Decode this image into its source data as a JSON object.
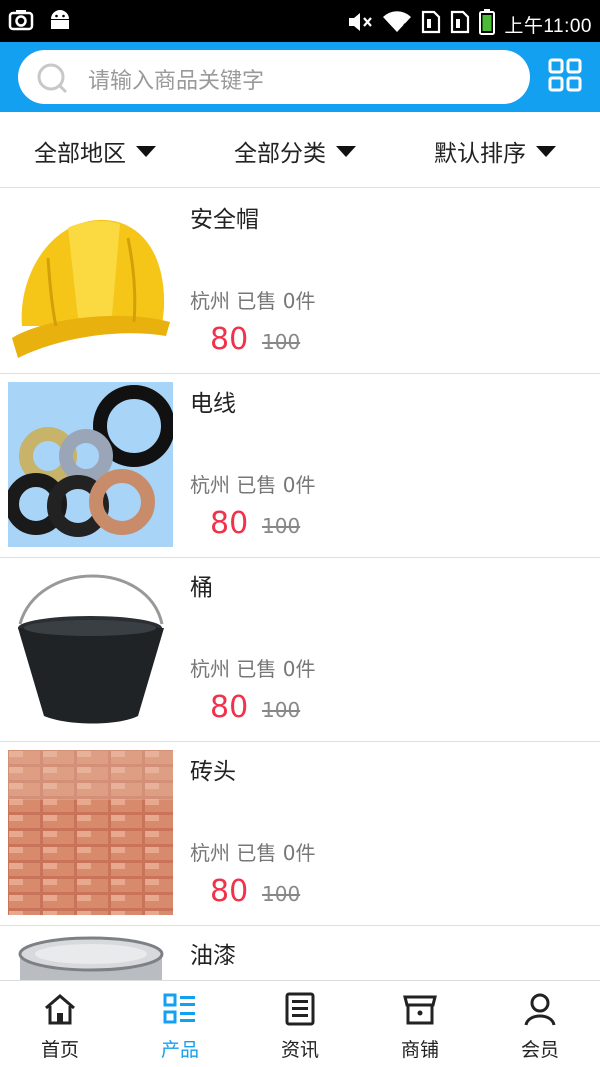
{
  "status_bar": {
    "time": "上午11:00",
    "left_icons": [
      "camera-icon",
      "android-icon"
    ],
    "right_icons": [
      "mute-icon",
      "wifi-icon",
      "sim1-icon",
      "sim2-icon",
      "battery-icon"
    ]
  },
  "search": {
    "placeholder": "请输入商品关键字"
  },
  "header": {
    "accent_color": "#14a0f0",
    "menu_icon": "grid-icon"
  },
  "filters": [
    {
      "label": "全部地区"
    },
    {
      "label": "全部分类"
    },
    {
      "label": "默认排序"
    }
  ],
  "products": [
    {
      "name": "安全帽",
      "meta": "杭州 已售 0件",
      "price": "80",
      "old_price": "100",
      "image": "hard-hat"
    },
    {
      "name": "电线",
      "meta": "杭州 已售 0件",
      "price": "80",
      "old_price": "100",
      "image": "wire-coils"
    },
    {
      "name": "桶",
      "meta": "杭州 已售 0件",
      "price": "80",
      "old_price": "100",
      "image": "bucket"
    },
    {
      "name": "砖头",
      "meta": "杭州 已售 0件",
      "price": "80",
      "old_price": "100",
      "image": "bricks"
    },
    {
      "name": "油漆",
      "meta": "",
      "price": "",
      "old_price": "",
      "image": "paint-can"
    }
  ],
  "price_color": "#f0324b",
  "bottom_nav": [
    {
      "label": "首页",
      "icon": "home-icon",
      "active": false
    },
    {
      "label": "产品",
      "icon": "product-list-icon",
      "active": true
    },
    {
      "label": "资讯",
      "icon": "news-icon",
      "active": false
    },
    {
      "label": "商铺",
      "icon": "shop-icon",
      "active": false
    },
    {
      "label": "会员",
      "icon": "member-icon",
      "active": false
    }
  ]
}
